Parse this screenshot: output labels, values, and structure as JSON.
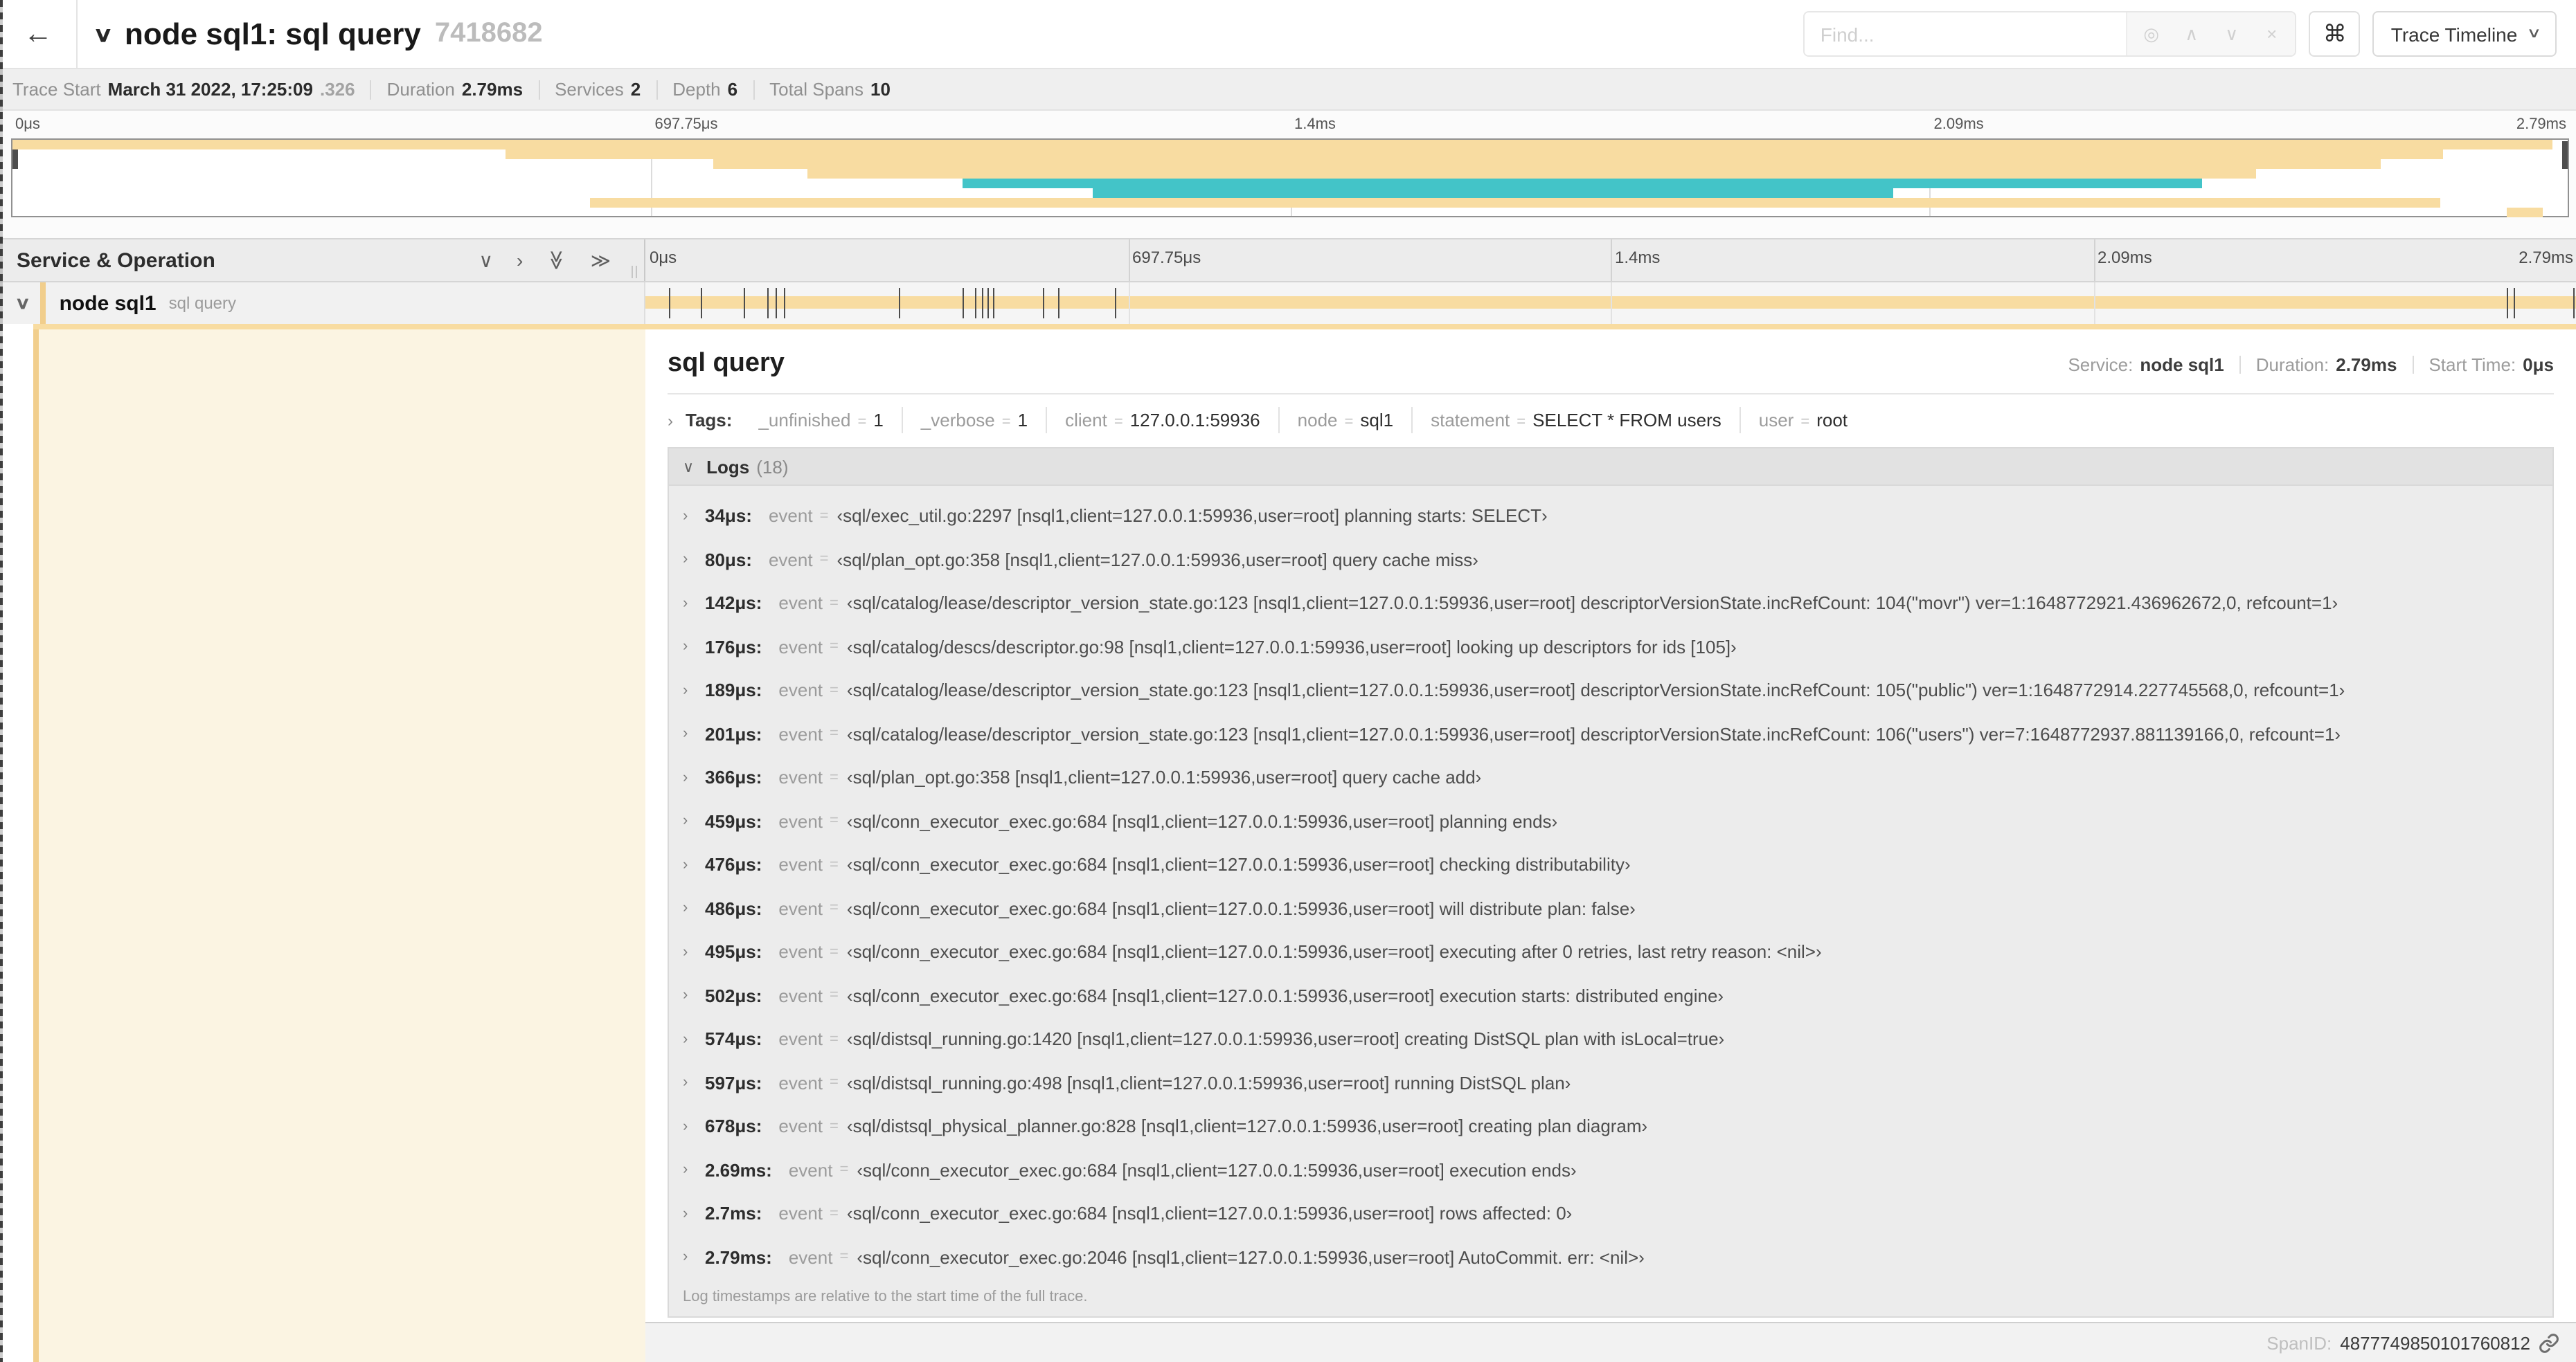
{
  "colors": {
    "span": "#F8DCA1",
    "span_accent": "#F1CE8C",
    "span_tint": "#FBF4E2",
    "teal": "#43C4C8",
    "tick": "#4C4C4C"
  },
  "icons": {
    "back": "←",
    "collapse_down": "∨",
    "chevron_right": "›",
    "double_down": "≫",
    "double_right": "≫",
    "up": "∧",
    "down": "∨",
    "close": "×",
    "locate": "◎",
    "command": "⌘",
    "view_chevron": "∨",
    "title_chevron": "∨",
    "row_chevron": "∨",
    "tags_chevron": "›",
    "logs_chevron": "∨",
    "log_row_chevron": "›"
  },
  "topbar": {
    "title": "node sql1: sql query",
    "trace_id": "7418682",
    "find_placeholder": "Find...",
    "view_selector_label": "Trace Timeline"
  },
  "meta": {
    "items": [
      {
        "label": "Trace Start",
        "value": "March 31 2022, 17:25:09",
        "suffix": ".326"
      },
      {
        "label": "Duration",
        "value": "2.79ms"
      },
      {
        "label": "Services",
        "value": "2"
      },
      {
        "label": "Depth",
        "value": "6"
      },
      {
        "label": "Total Spans",
        "value": "10"
      }
    ]
  },
  "minimap": {
    "ticks": [
      {
        "label": "0μs",
        "pct": 0
      },
      {
        "label": "697.75μs",
        "pct": 25
      },
      {
        "label": "1.4ms",
        "pct": 50
      },
      {
        "label": "2.09ms",
        "pct": 75
      },
      {
        "label": "2.79ms",
        "pct": 100
      }
    ],
    "gridline_pcts": [
      25,
      50,
      75
    ],
    "spans": [
      {
        "start": 0,
        "end": 99.4,
        "color": "span"
      },
      {
        "start": 19.3,
        "end": 95.1,
        "color": "span"
      },
      {
        "start": 27.4,
        "end": 92.7,
        "color": "span"
      },
      {
        "start": 31.1,
        "end": 87.8,
        "color": "span"
      },
      {
        "start": 37.2,
        "end": 85.7,
        "color": "teal"
      },
      {
        "start": 42.3,
        "end": 73.6,
        "color": "teal"
      },
      {
        "start": 22.6,
        "end": 95.0,
        "color": "span"
      },
      {
        "start": 97.6,
        "end": 99.0,
        "color": "span"
      }
    ]
  },
  "timeline": {
    "left_header": "Service & Operation",
    "ticks": [
      {
        "label": "0μs",
        "pct": 0
      },
      {
        "label": "697.75μs",
        "pct": 25
      },
      {
        "label": "1.4ms",
        "pct": 50
      },
      {
        "label": "2.09ms",
        "pct": 75
      },
      {
        "label": "2.79ms",
        "pct": 100
      }
    ],
    "gridline_pcts": [
      25,
      50,
      75
    ],
    "row": {
      "service": "node sql1",
      "operation": "sql query"
    },
    "log_marker_pcts": [
      1.22,
      2.87,
      5.09,
      6.31,
      6.77,
      7.2,
      13.12,
      16.45,
      17.06,
      17.42,
      17.74,
      17.99,
      20.57,
      21.4,
      24.3,
      96.42,
      96.77,
      99.85
    ]
  },
  "detail": {
    "title": "sql query",
    "overview": [
      {
        "label": "Service:",
        "value": "node sql1"
      },
      {
        "label": "Duration:",
        "value": "2.79ms"
      },
      {
        "label": "Start Time:",
        "value": "0μs"
      }
    ],
    "tags_label": "Tags:",
    "tags": [
      {
        "key": "_unfinished",
        "value": "1"
      },
      {
        "key": "_verbose",
        "value": "1"
      },
      {
        "key": "client",
        "value": "127.0.0.1:59936"
      },
      {
        "key": "node",
        "value": "sql1"
      },
      {
        "key": "statement",
        "value": "SELECT * FROM users"
      },
      {
        "key": "user",
        "value": "root"
      }
    ],
    "logs_label": "Logs",
    "logs_count": "(18)",
    "event_key": "event",
    "logs": [
      {
        "time": "34μs",
        "message": "‹sql/exec_util.go:2297 [nsql1,client=127.0.0.1:59936,user=root] planning starts: SELECT›"
      },
      {
        "time": "80μs",
        "message": "‹sql/plan_opt.go:358 [nsql1,client=127.0.0.1:59936,user=root] query cache miss›"
      },
      {
        "time": "142μs",
        "message": "‹sql/catalog/lease/descriptor_version_state.go:123 [nsql1,client=127.0.0.1:59936,user=root] descriptorVersionState.incRefCount: 104(\"movr\") ver=1:1648772921.436962672,0, refcount=1›"
      },
      {
        "time": "176μs",
        "message": "‹sql/catalog/descs/descriptor.go:98 [nsql1,client=127.0.0.1:59936,user=root] looking up descriptors for ids [105]›"
      },
      {
        "time": "189μs",
        "message": "‹sql/catalog/lease/descriptor_version_state.go:123 [nsql1,client=127.0.0.1:59936,user=root] descriptorVersionState.incRefCount: 105(\"public\") ver=1:1648772914.227745568,0, refcount=1›"
      },
      {
        "time": "201μs",
        "message": "‹sql/catalog/lease/descriptor_version_state.go:123 [nsql1,client=127.0.0.1:59936,user=root] descriptorVersionState.incRefCount: 106(\"users\") ver=7:1648772937.881139166,0, refcount=1›"
      },
      {
        "time": "366μs",
        "message": "‹sql/plan_opt.go:358 [nsql1,client=127.0.0.1:59936,user=root] query cache add›"
      },
      {
        "time": "459μs",
        "message": "‹sql/conn_executor_exec.go:684 [nsql1,client=127.0.0.1:59936,user=root] planning ends›"
      },
      {
        "time": "476μs",
        "message": "‹sql/conn_executor_exec.go:684 [nsql1,client=127.0.0.1:59936,user=root] checking distributability›"
      },
      {
        "time": "486μs",
        "message": "‹sql/conn_executor_exec.go:684 [nsql1,client=127.0.0.1:59936,user=root] will distribute plan: false›"
      },
      {
        "time": "495μs",
        "message": "‹sql/conn_executor_exec.go:684 [nsql1,client=127.0.0.1:59936,user=root] executing after 0 retries, last retry reason: <nil>›"
      },
      {
        "time": "502μs",
        "message": "‹sql/conn_executor_exec.go:684 [nsql1,client=127.0.0.1:59936,user=root] execution starts: distributed engine›"
      },
      {
        "time": "574μs",
        "message": "‹sql/distsql_running.go:1420 [nsql1,client=127.0.0.1:59936,user=root] creating DistSQL plan with isLocal=true›"
      },
      {
        "time": "597μs",
        "message": "‹sql/distsql_running.go:498 [nsql1,client=127.0.0.1:59936,user=root] running DistSQL plan›"
      },
      {
        "time": "678μs",
        "message": "‹sql/distsql_physical_planner.go:828 [nsql1,client=127.0.0.1:59936,user=root] creating plan diagram›"
      },
      {
        "time": "2.69ms",
        "message": "‹sql/conn_executor_exec.go:684 [nsql1,client=127.0.0.1:59936,user=root] execution ends›"
      },
      {
        "time": "2.7ms",
        "message": "‹sql/conn_executor_exec.go:684 [nsql1,client=127.0.0.1:59936,user=root] rows affected: 0›"
      },
      {
        "time": "2.79ms",
        "message": "‹sql/conn_executor_exec.go:2046 [nsql1,client=127.0.0.1:59936,user=root] AutoCommit. err: <nil>›"
      }
    ],
    "logs_note": "Log timestamps are relative to the start time of the full trace.",
    "span_id_label": "SpanID:",
    "span_id": "4877749850101760812"
  }
}
